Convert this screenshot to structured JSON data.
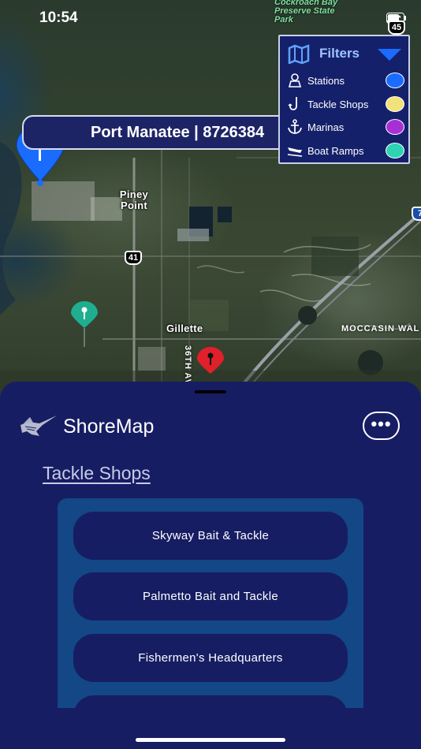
{
  "status_bar": {
    "time": "10:54"
  },
  "map": {
    "preserve_label": "Cockroach Bay Preserve State Park",
    "places": {
      "piney_point": "Piney Point",
      "gillette": "Gillette"
    },
    "roads": {
      "us41": "41",
      "hwy45": "45",
      "interstate": "7",
      "moccasin": "MOCCASIN WAL",
      "ave36": "36TH AV"
    }
  },
  "station_banner": {
    "text": "Port Manatee | 8726384"
  },
  "filters": {
    "title": "Filters",
    "items": [
      {
        "label": "Stations",
        "icon": "station-icon",
        "color": "#1a6cff"
      },
      {
        "label": "Tackle Shops",
        "icon": "hook-icon",
        "color": "#f3e27a"
      },
      {
        "label": "Marinas",
        "icon": "anchor-icon",
        "color": "#a82fd6"
      },
      {
        "label": "Boat Ramps",
        "icon": "boat-ramp-icon",
        "color": "#2ed3b3"
      }
    ]
  },
  "sheet": {
    "app_name": "ShoreMap",
    "more_label": "•••",
    "section_title": "Tackle Shops",
    "shops": [
      {
        "label": "Skyway Bait & Tackle"
      },
      {
        "label": "Palmetto Bait and Tackle"
      },
      {
        "label": "Fishermen's Headquarters"
      },
      {
        "label": ""
      }
    ]
  },
  "colors": {
    "sheet_bg": "#171d63",
    "panel_bg": "#134786",
    "pin_blue": "#1a6cff",
    "pin_teal": "#1fae8f",
    "pin_red": "#e0202a"
  }
}
